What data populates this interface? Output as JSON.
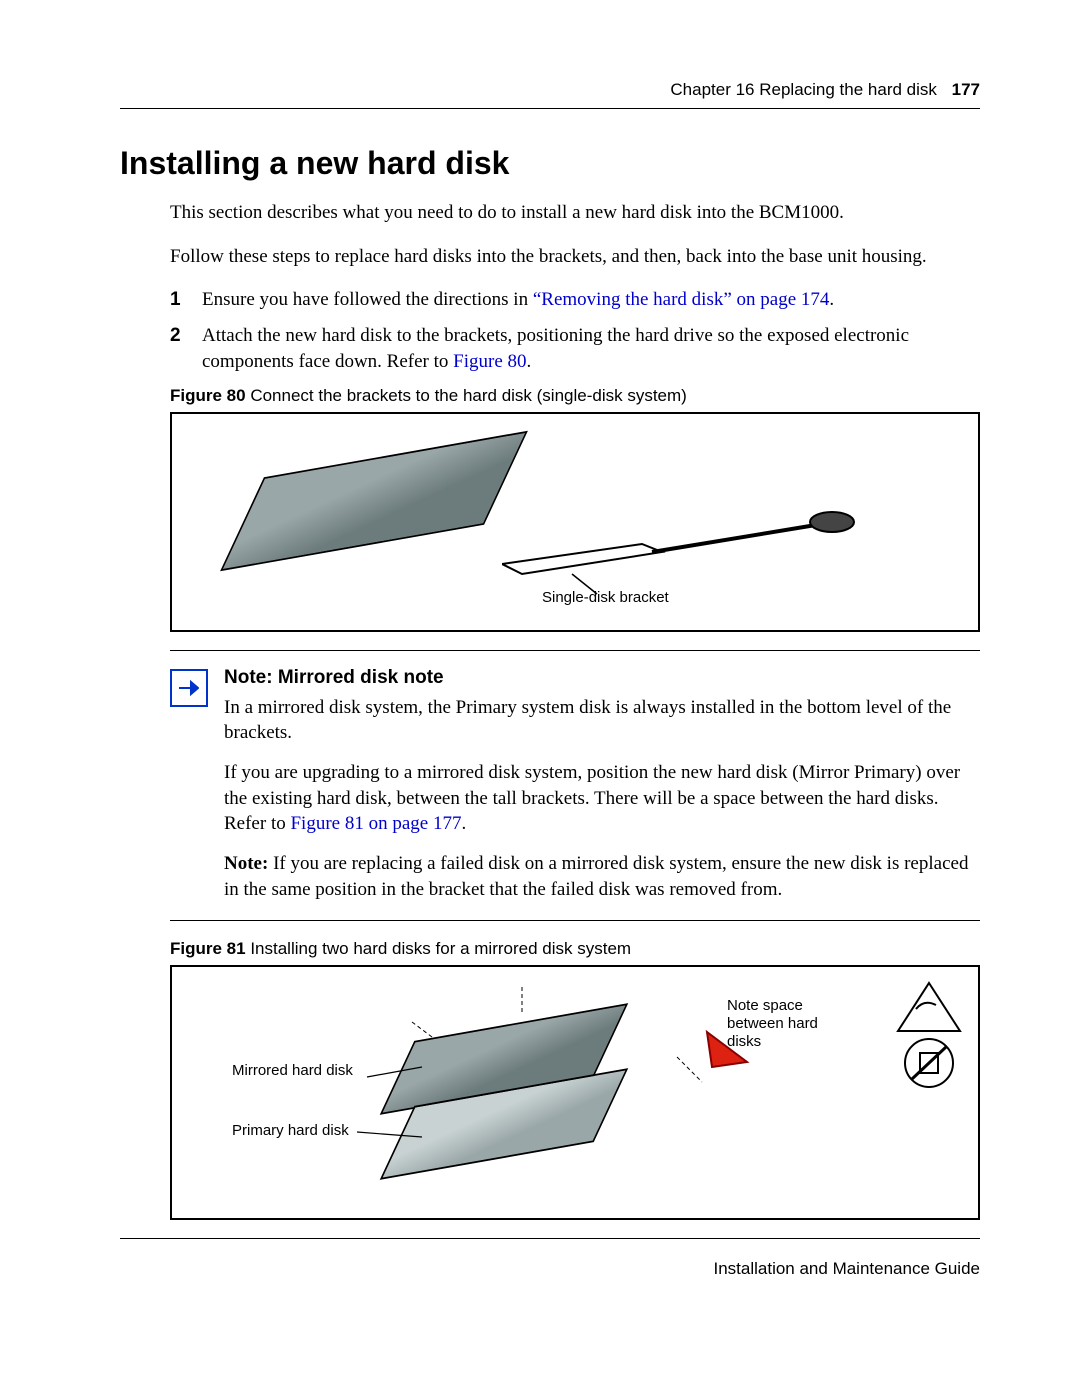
{
  "header": {
    "chapter": "Chapter 16  Replacing the hard disk",
    "page": "177"
  },
  "title": "Installing a new hard disk",
  "intro1": "This section describes what you need to do to install a new hard disk into the BCM1000.",
  "intro2": "Follow these steps to replace hard disks into the brackets, and then, back into the base unit housing.",
  "steps": {
    "s1_a": "Ensure you have followed the directions in ",
    "s1_link": "“Removing the hard disk” on page 174",
    "s1_b": ".",
    "s2_a": "Attach the new hard disk to the brackets, positioning the hard drive so the exposed electronic components face down. Refer to ",
    "s2_link": "Figure 80",
    "s2_b": "."
  },
  "fig80": {
    "label_bold": "Figure 80",
    "label_rest": "   Connect the brackets to the hard disk (single-disk system)",
    "callout": "Single-disk bracket"
  },
  "note": {
    "title_bold": "Note:",
    "title_rest": " Mirrored disk note",
    "p1": "In a mirrored disk system, the Primary system disk is always installed in the bottom level of the brackets.",
    "p2_a": "If you are upgrading to a mirrored disk system, position the new hard disk (Mirror Primary) over the existing hard disk, between the tall brackets. There will be a space between the hard disks. Refer to ",
    "p2_link": "Figure 81 on page 177",
    "p2_b": ".",
    "p3_bold": "Note:",
    "p3_rest": " If you are replacing a failed disk on a mirrored disk system, ensure the new disk is replaced in the same position in the bracket that the failed disk was removed from."
  },
  "fig81": {
    "label_bold": "Figure 81",
    "label_rest": "   Installing two hard disks for a mirrored disk system",
    "callout_mirrored": "Mirrored hard disk",
    "callout_primary": "Primary hard disk",
    "callout_space": "Note space between hard disks"
  },
  "footer": "Installation and Maintenance Guide"
}
